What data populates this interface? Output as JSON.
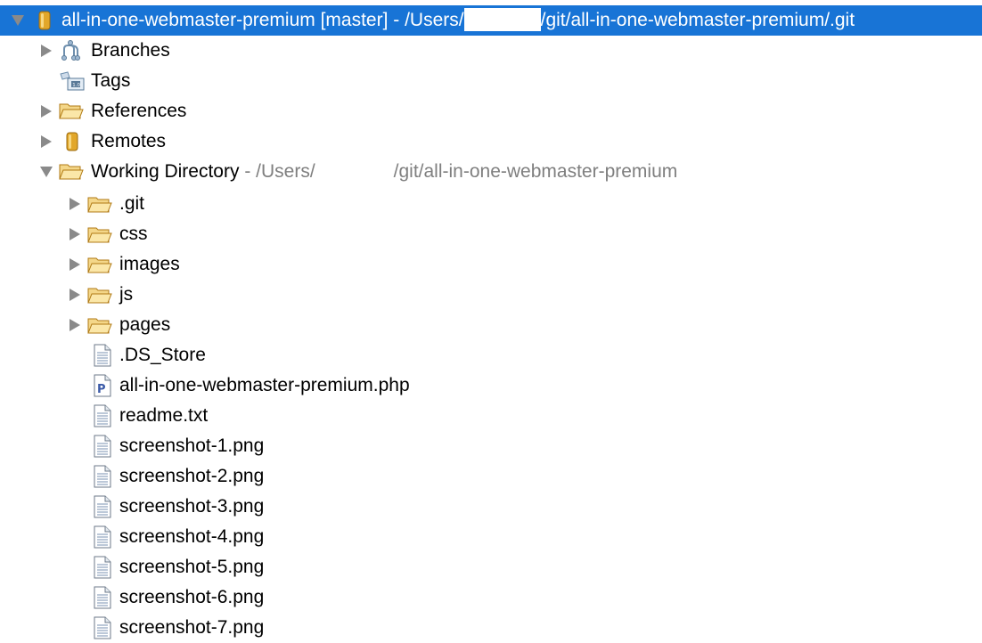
{
  "root": {
    "name": "all-in-one-webmaster-premium [master] - /Users/",
    "path_tail": "/git/all-in-one-webmaster-premium/.git",
    "expanded": true,
    "selected": true
  },
  "nodes": [
    {
      "label": "Branches"
    },
    {
      "label": "Tags"
    },
    {
      "label": "References"
    },
    {
      "label": "Remotes"
    },
    {
      "label": "Working Directory",
      "path_prefix": " - /Users/",
      "path_tail": "/git/all-in-one-webmaster-premium"
    }
  ],
  "working_dir_children": [
    {
      "label": ".git"
    },
    {
      "label": "css"
    },
    {
      "label": "images"
    },
    {
      "label": "js"
    },
    {
      "label": "pages"
    },
    {
      "label": ".DS_Store"
    },
    {
      "label": "all-in-one-webmaster-premium.php"
    },
    {
      "label": "readme.txt"
    },
    {
      "label": "screenshot-1.png"
    },
    {
      "label": "screenshot-2.png"
    },
    {
      "label": "screenshot-3.png"
    },
    {
      "label": "screenshot-4.png"
    },
    {
      "label": "screenshot-5.png"
    },
    {
      "label": "screenshot-6.png"
    },
    {
      "label": "screenshot-7.png"
    }
  ],
  "colors": {
    "selection": "#1874d6",
    "path_gray": "#7f7f7f",
    "folder": "#e8b84a"
  },
  "icons": {
    "chevron_right": "chevron-right-icon",
    "chevron_down": "chevron-down-icon",
    "repository": "repository-icon",
    "branches": "branches-icon",
    "tags": "tags-icon",
    "folder": "folder-icon",
    "remotes": "remotes-icon",
    "file": "file-icon",
    "php_file": "php-file-icon"
  }
}
